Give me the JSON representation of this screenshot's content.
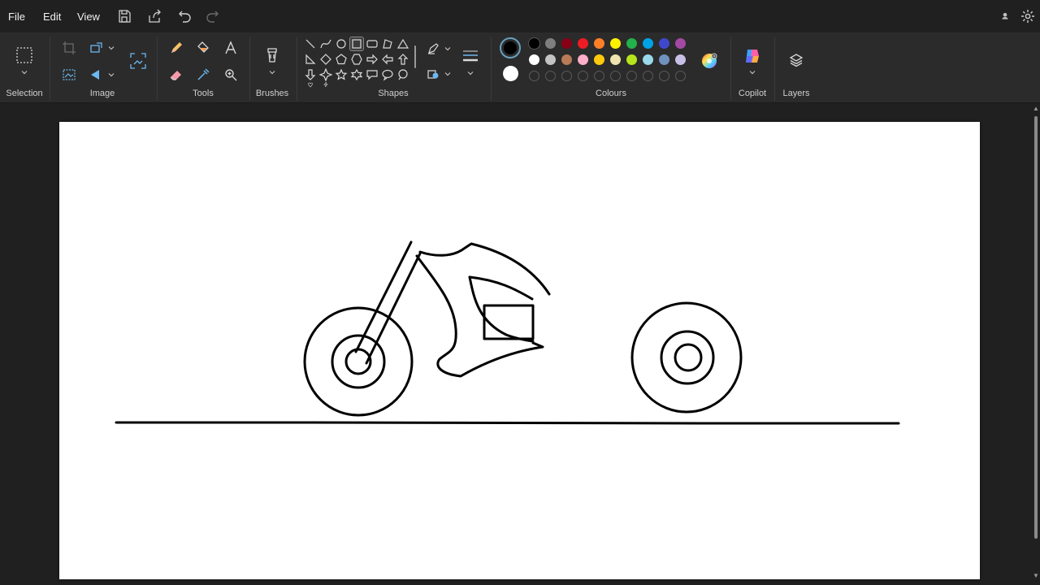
{
  "menu": {
    "file": "File",
    "edit": "Edit",
    "view": "View"
  },
  "groups": {
    "selection": "Selection",
    "image": "Image",
    "tools": "Tools",
    "brushes": "Brushes",
    "shapes": "Shapes",
    "colours": "Colours",
    "copilot": "Copilot",
    "layers": "Layers"
  },
  "current_colors": {
    "primary": "#000000",
    "secondary": "#ffffff"
  },
  "palette_row1": [
    "#000000",
    "#7f7f7f",
    "#880015",
    "#ed1c24",
    "#ff7f27",
    "#fff200",
    "#22b14c",
    "#00a2e8",
    "#3f48cc",
    "#a349a4"
  ],
  "palette_row2": [
    "#ffffff",
    "#c3c3c3",
    "#b97a57",
    "#ffaec9",
    "#ffc90e",
    "#efe4b0",
    "#b5e61d",
    "#99d9ea",
    "#7092be",
    "#c8bfe7"
  ],
  "canvas": {
    "background": "#ffffff",
    "stroke": "#000000"
  }
}
